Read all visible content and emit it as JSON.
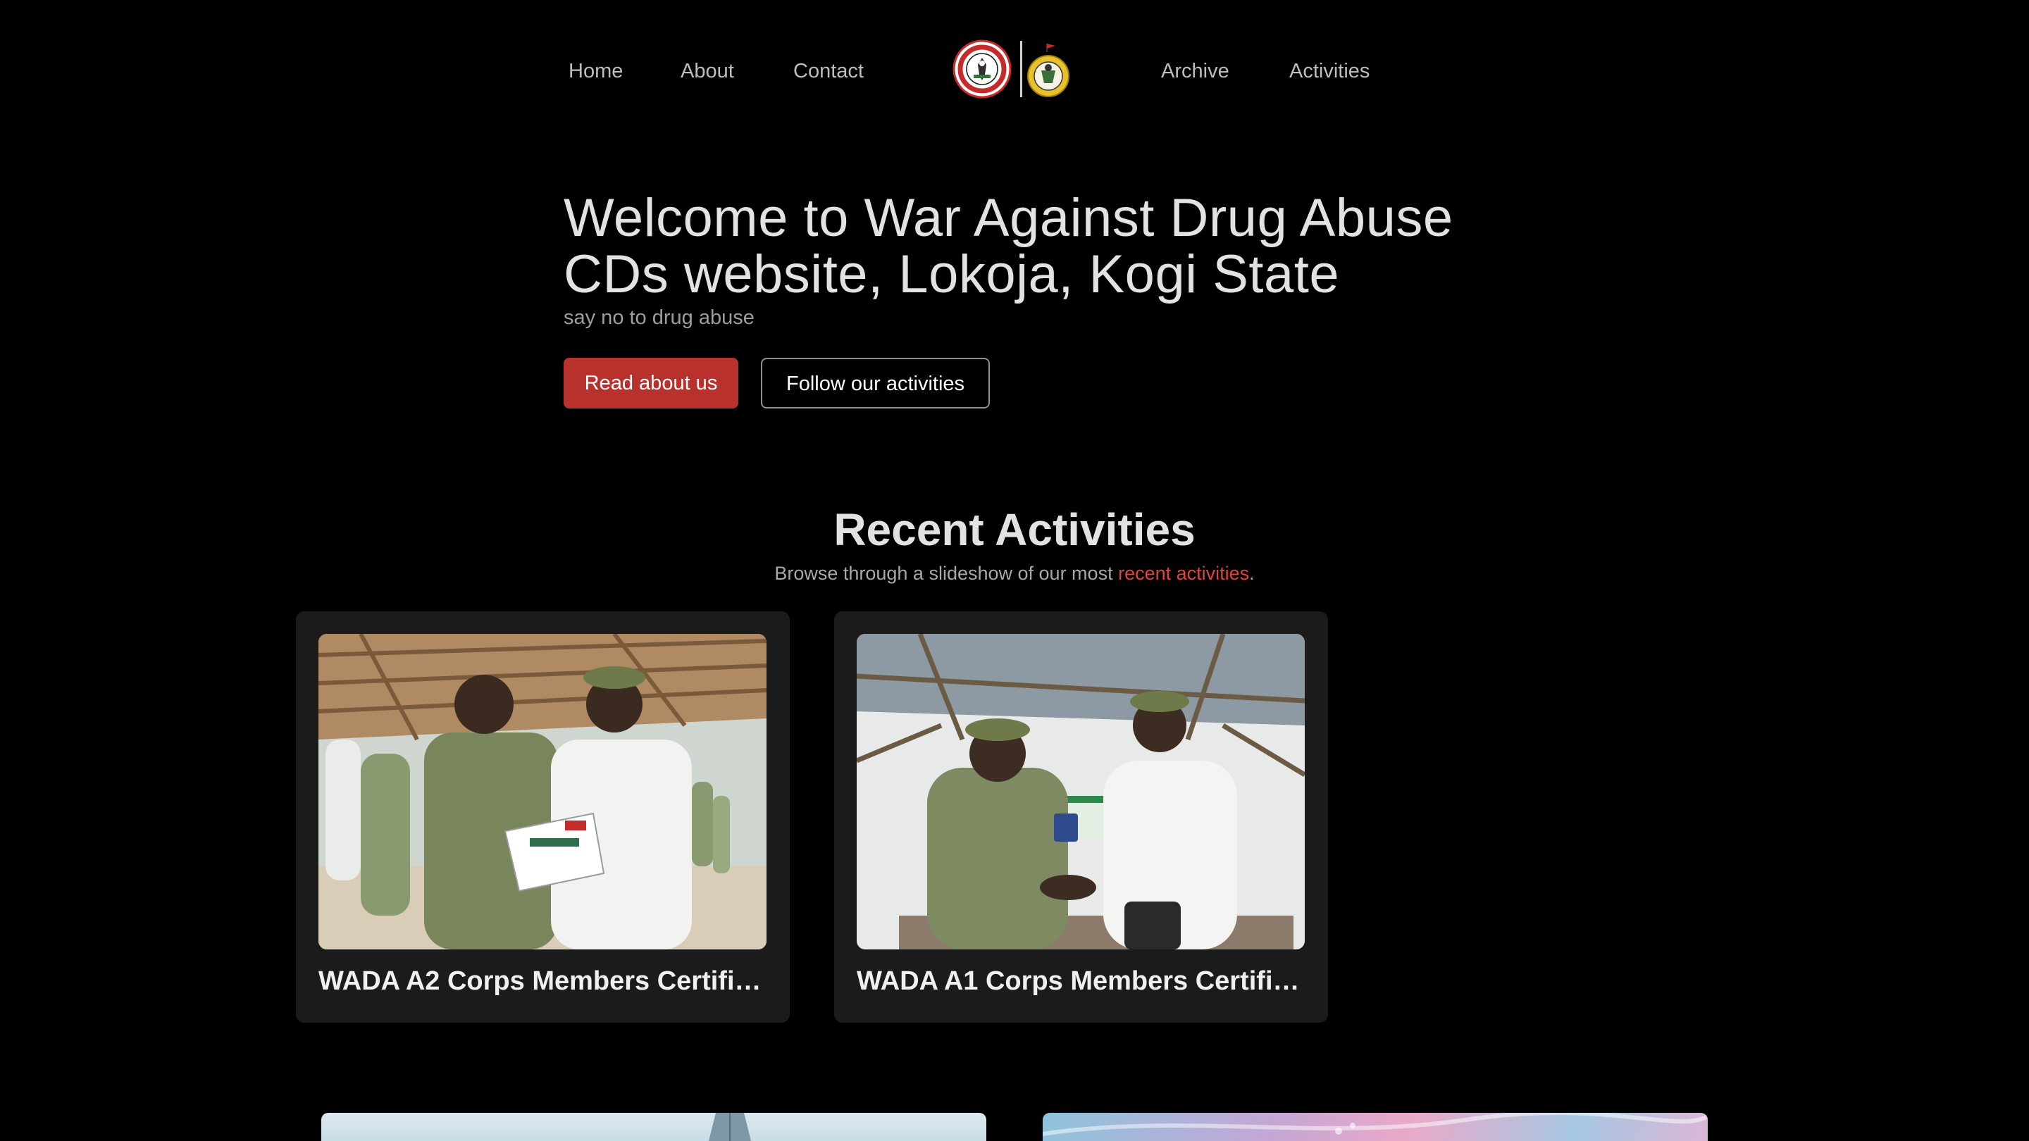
{
  "nav": {
    "links_left": [
      "Home",
      "About",
      "Contact"
    ],
    "links_right": [
      "Archive",
      "Activities"
    ]
  },
  "logos": {
    "left": "red-circular-seal-icon",
    "right": "yellow-circular-seal-icon"
  },
  "hero": {
    "title": "Welcome to War Against Drug Abuse CDs website, Lokoja, Kogi State",
    "subtitle": "say no to drug abuse",
    "primary_button": "Read about us",
    "secondary_button": "Follow our activities"
  },
  "activities": {
    "title": "Recent Activities",
    "subtitle_prefix": "Browse through a slideshow of our most ",
    "subtitle_link": "recent activities",
    "subtitle_suffix": ".",
    "cards": [
      {
        "caption": "WADA A2 Corps Members Certific..."
      },
      {
        "caption": "WADA A1 Corps Members Certific..."
      }
    ]
  },
  "colors": {
    "background": "#000000",
    "accent": "#b8312c",
    "link_accent": "#e2413c",
    "card": "#1b1b1b"
  }
}
